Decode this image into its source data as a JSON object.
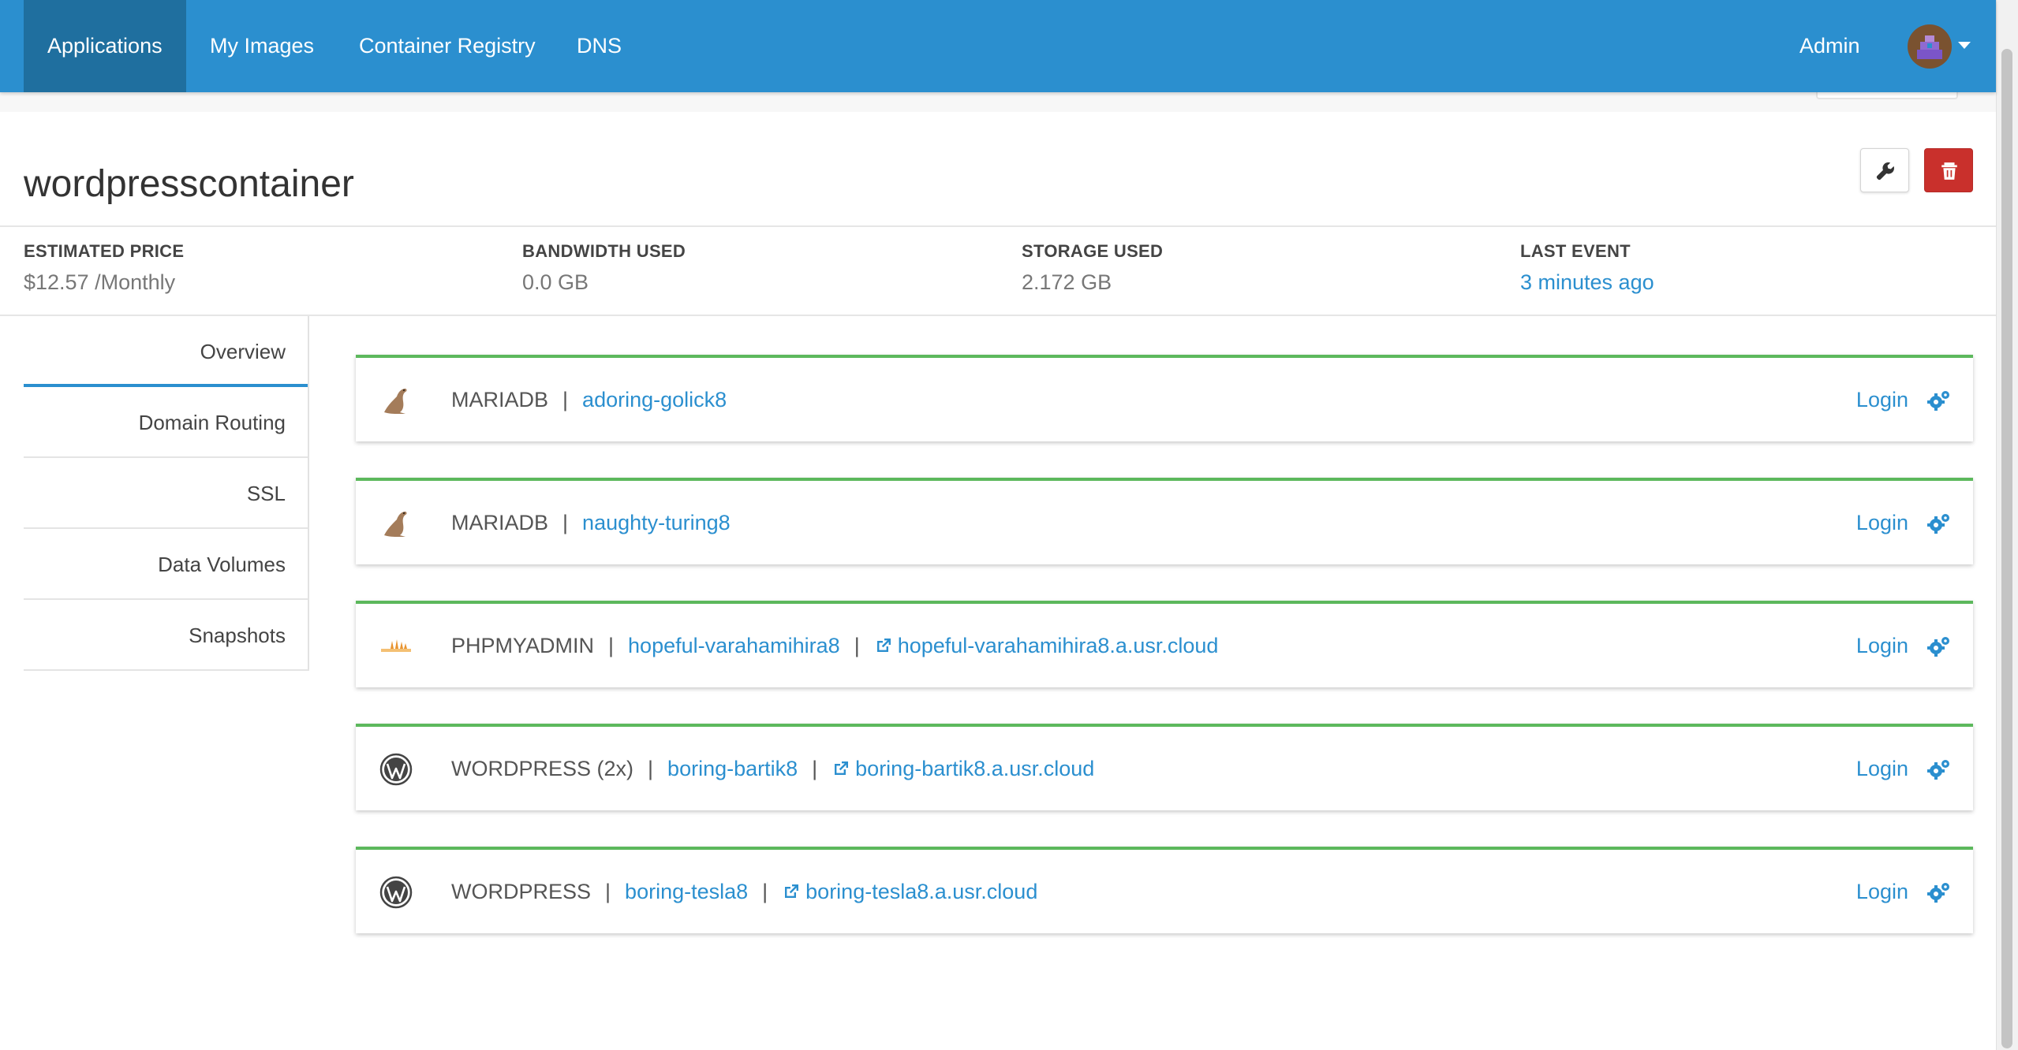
{
  "nav": {
    "items": [
      {
        "label": "Applications",
        "active": true
      },
      {
        "label": "My Images"
      },
      {
        "label": "Container Registry"
      },
      {
        "label": "DNS"
      }
    ],
    "user_label": "Admin"
  },
  "page": {
    "title": "wordpresscontainer",
    "actions": {
      "edit_icon": "wrench-icon",
      "delete_icon": "trash-icon"
    }
  },
  "stats": [
    {
      "label": "ESTIMATED PRICE",
      "value": "$12.57 /Monthly"
    },
    {
      "label": "BANDWIDTH USED",
      "value": "0.0 GB"
    },
    {
      "label": "STORAGE USED",
      "value": "2.172 GB"
    },
    {
      "label": "LAST EVENT",
      "value": "3 minutes ago"
    }
  ],
  "sidebar": {
    "items": [
      {
        "label": "Overview",
        "active": true
      },
      {
        "label": "Domain Routing"
      },
      {
        "label": "SSL"
      },
      {
        "label": "Data Volumes"
      },
      {
        "label": "Snapshots"
      }
    ]
  },
  "services": [
    {
      "icon": "mariadb-seal-icon",
      "type": "MARIADB",
      "name": "adoring-golick8",
      "login": "Login"
    },
    {
      "icon": "mariadb-seal-icon",
      "type": "MARIADB",
      "name": "naughty-turing8",
      "login": "Login"
    },
    {
      "icon": "phpmyadmin-icon",
      "type": "PHPMYADMIN",
      "name": "hopeful-varahamihira8",
      "url": "hopeful-varahamihira8.a.usr.cloud",
      "login": "Login"
    },
    {
      "icon": "wordpress-icon",
      "type": "WORDPRESS (2x)",
      "name": "boring-bartik8",
      "url": "boring-bartik8.a.usr.cloud",
      "login": "Login"
    },
    {
      "icon": "wordpress-icon",
      "type": "WORDPRESS",
      "name": "boring-tesla8",
      "url": "boring-tesla8.a.usr.cloud",
      "login": "Login"
    }
  ],
  "colors": {
    "nav_bg": "#2b8fcf",
    "nav_active_bg": "#1f6f9f",
    "link": "#2b8fcf",
    "status_running": "#5cb85c",
    "danger": "#c9302c"
  }
}
